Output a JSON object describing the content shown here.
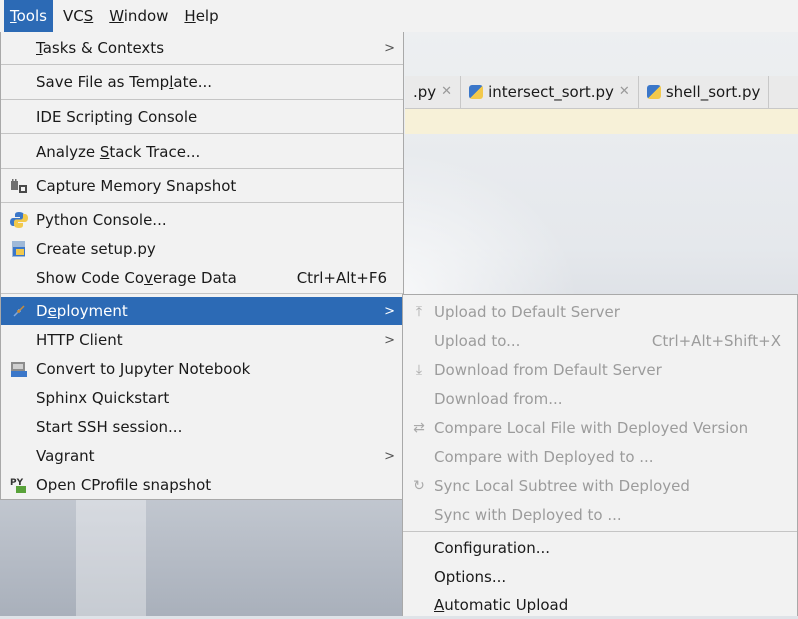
{
  "menubar": {
    "items": [
      {
        "label": "Tools",
        "mnemonic": "T",
        "rest": "ools"
      },
      {
        "label": "VCS",
        "pre": "VC",
        "mnemonic": "S"
      },
      {
        "label": "Window",
        "mnemonic": "W",
        "rest": "indow"
      },
      {
        "label": "Help",
        "mnemonic": "H",
        "rest": "elp"
      }
    ]
  },
  "tabs": [
    {
      "label": ".py"
    },
    {
      "label": "intersect_sort.py"
    },
    {
      "label": "shell_sort.py"
    }
  ],
  "tools_menu": {
    "tasks": {
      "pre": "",
      "mn": "T",
      "post": "asks & Contexts"
    },
    "save_template": {
      "pre": "Save File as Temp",
      "mn": "l",
      "post": "ate..."
    },
    "ide_scripting": "IDE Scripting Console",
    "analyze": {
      "pre": "Analyze ",
      "mn": "S",
      "post": "tack Trace..."
    },
    "capture_memory": "Capture Memory Snapshot",
    "python_console": "Python Console...",
    "create_setup": "Create setup.py",
    "coverage": {
      "pre": "Show Code Co",
      "mn": "v",
      "post": "erage Data",
      "shortcut": "Ctrl+Alt+F6"
    },
    "deployment": {
      "pre": "D",
      "mn": "e",
      "post": "ployment"
    },
    "http_client": "HTTP Client",
    "jupyter": "Convert to Jupyter Notebook",
    "sphinx": "Sphinx Quickstart",
    "ssh": "Start SSH session...",
    "vagrant": "Vagrant",
    "cprofile": "Open CProfile snapshot"
  },
  "deployment_menu": {
    "upload_default": "Upload to Default Server",
    "upload_to": "Upload to...",
    "upload_to_shortcut": "Ctrl+Alt+Shift+X",
    "download_default": "Download from Default Server",
    "download_from": "Download from...",
    "compare_local": "Compare Local File with Deployed Version",
    "compare_with": "Compare with Deployed to ...",
    "sync_local": "Sync Local Subtree with Deployed",
    "sync_with": "Sync with Deployed to ...",
    "configuration": "Configuration...",
    "options": "Options...",
    "automatic": {
      "mn": "A",
      "post": "utomatic Upload"
    }
  },
  "colors": {
    "selection": "#2c6ab5",
    "menu_bg": "#f2f2f2",
    "disabled": "#9c9c9c"
  }
}
